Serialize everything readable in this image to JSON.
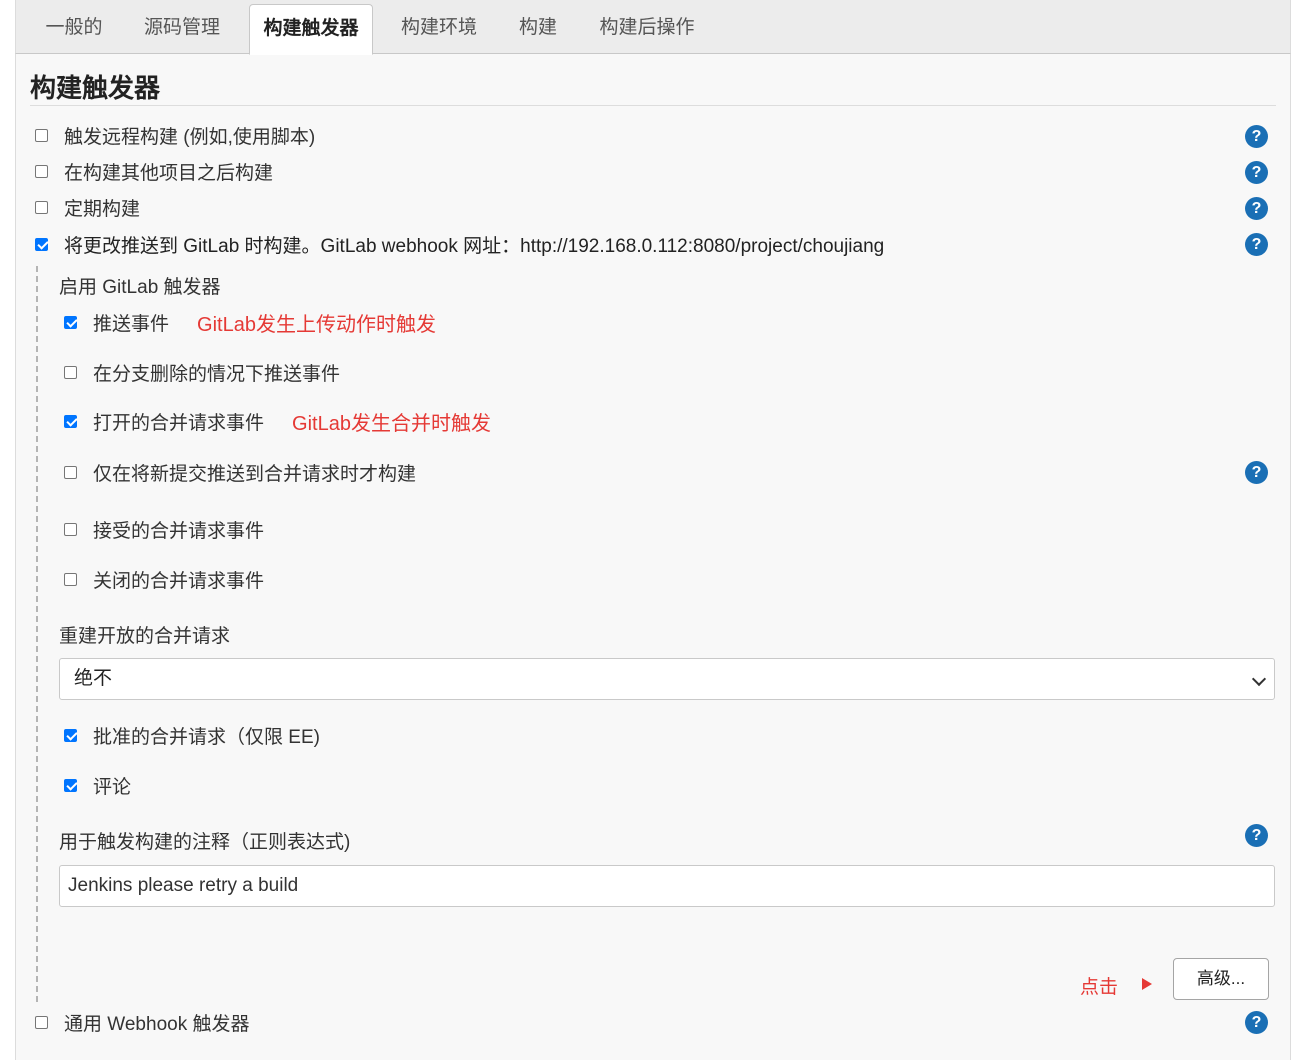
{
  "tabs": [
    {
      "label": "一般的"
    },
    {
      "label": "源码管理"
    },
    {
      "label": "构建触发器"
    },
    {
      "label": "构建环境"
    },
    {
      "label": "构建"
    },
    {
      "label": "构建后操作"
    }
  ],
  "section": {
    "title": "构建触发器"
  },
  "triggers": [
    {
      "label": "触发远程构建 (例如,使用脚本)",
      "checked": false
    },
    {
      "label": "在构建其他项目之后构建",
      "checked": false
    },
    {
      "label": "定期构建",
      "checked": false
    },
    {
      "label": "将更改推送到 GitLab 时构建。GitLab webhook 网址：http://192.168.0.112:8080/project/choujiang",
      "checked": true
    }
  ],
  "gitlab": {
    "heading": "启用 GitLab 触发器",
    "options": [
      {
        "label": "推送事件",
        "checked": true,
        "annotation": "GitLab发生上传动作时触发"
      },
      {
        "label": "在分支删除的情况下推送事件",
        "checked": false
      },
      {
        "label": "打开的合并请求事件",
        "checked": true,
        "annotation": "GitLab发生合并时触发"
      },
      {
        "label": "仅在将新提交推送到合并请求时才构建",
        "checked": false
      },
      {
        "label": "接受的合并请求事件",
        "checked": false
      },
      {
        "label": "关闭的合并请求事件",
        "checked": false
      }
    ],
    "rebuild_label": "重建开放的合并请求",
    "rebuild_value": "绝不",
    "approved_label": "批准的合并请求（仅限 EE)",
    "comment_label": "评论",
    "comment_regex_label": "用于触发构建的注释（正则表达式)",
    "comment_regex_value": "Jenkins please retry a build",
    "advanced_button": "高级...",
    "click_note": "点击"
  },
  "webhook_trigger": {
    "label": "通用 Webhook 触发器",
    "checked": false
  },
  "icons": {
    "help": "help-icon",
    "dropdown": "chevron-down-icon"
  },
  "colors": {
    "accent": "#0075ff",
    "help": "#1a6fb5",
    "annotation": "#e53935"
  }
}
